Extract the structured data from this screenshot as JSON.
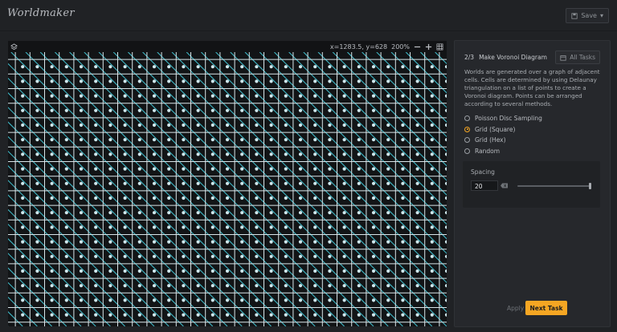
{
  "app": {
    "title": "Worldmaker"
  },
  "header": {
    "save_label": "Save",
    "save_caret": "▾"
  },
  "canvas": {
    "coords": "x=1283.5, y=628",
    "zoom": "200%",
    "icons": [
      "layers-icon",
      "zoom-out-icon",
      "zoom-in-icon",
      "grid-toggle-icon"
    ],
    "grid": {
      "line_color": "#d9e6ea",
      "diag_color": "#3fb6c4",
      "point_color": "#cfe7ec"
    }
  },
  "panel": {
    "step": "2/3",
    "task_title": "Make Voronoi Diagram",
    "all_tasks_label": "All Tasks",
    "description": "Worlds are generated over a graph of adjacent cells. Cells are determined by using Delaunay triangulation on a list of points to create a Voronoi diagram. Points can be arranged according to several methods.",
    "options": [
      {
        "label": "Poisson Disc Sampling",
        "selected": false
      },
      {
        "label": "Grid (Square)",
        "selected": true
      },
      {
        "label": "Grid (Hex)",
        "selected": false
      },
      {
        "label": "Random",
        "selected": false
      }
    ],
    "spacing": {
      "label": "Spacing",
      "value": "20",
      "slider_fraction": 1.0
    },
    "apply_label": "Apply",
    "next_label": "Next Task",
    "accent": "#f5a623"
  }
}
